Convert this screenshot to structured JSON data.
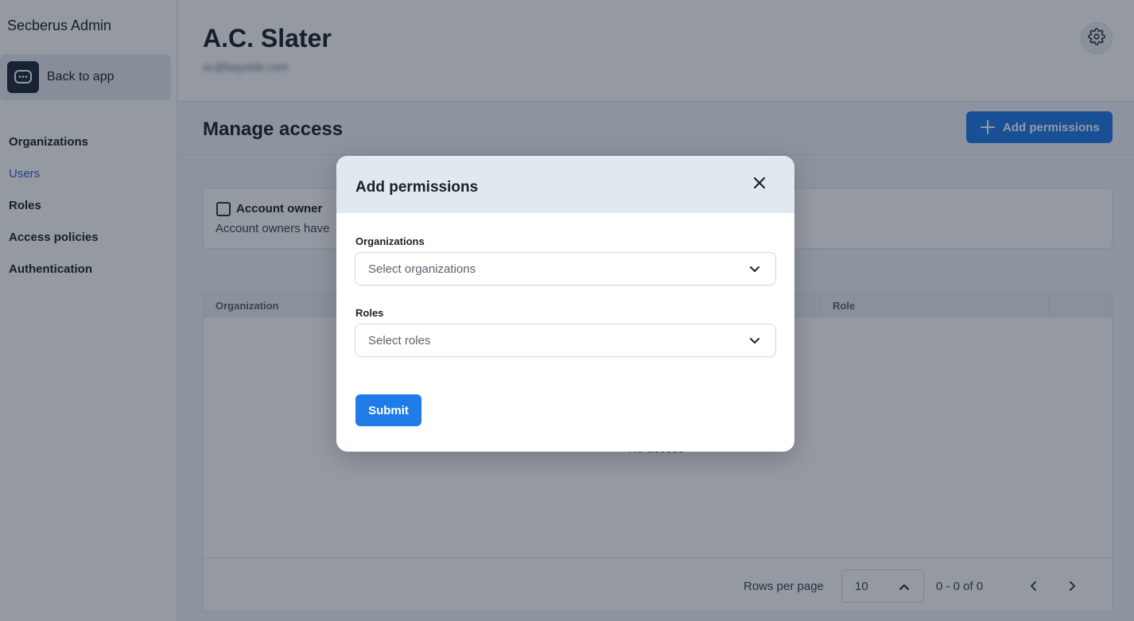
{
  "app": {
    "title": "Secberus Admin",
    "back_label": "Back to app"
  },
  "sidebar": {
    "items": [
      {
        "label": "Organizations",
        "active": false
      },
      {
        "label": "Users",
        "active": true
      },
      {
        "label": "Roles",
        "active": false
      },
      {
        "label": "Access policies",
        "active": false
      },
      {
        "label": "Authentication",
        "active": false
      }
    ]
  },
  "header": {
    "user_name": "A.C. Slater",
    "user_email": "ac@bayside.com"
  },
  "access": {
    "title": "Manage access",
    "add_button_label": "Add permissions",
    "account_owner_label": "Account owner",
    "account_owner_desc": "Account owners have"
  },
  "table": {
    "columns": [
      "Organization",
      "Role"
    ],
    "empty_message": "No access",
    "rows_per_page_label": "Rows per page",
    "rows_per_page_value": "10",
    "page_info": "0 - 0 of 0"
  },
  "modal": {
    "title": "Add permissions",
    "organizations_label": "Organizations",
    "organizations_placeholder": "Select organizations",
    "roles_label": "Roles",
    "roles_placeholder": "Select roles",
    "submit_label": "Submit"
  },
  "colors": {
    "accent": "#1f7be8",
    "active_nav": "#2a6ad8",
    "dark": "#1e2a3a"
  }
}
